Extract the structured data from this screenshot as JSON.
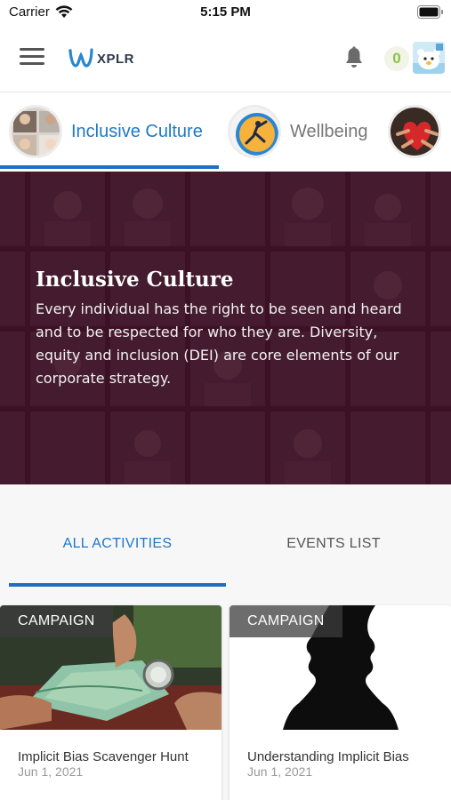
{
  "status_bar": {
    "carrier": "Carrier",
    "time": "5:15 PM"
  },
  "header": {
    "logo_text": "XPLR",
    "points": "0",
    "icons": [
      "menu-icon",
      "bell-icon",
      "avatar"
    ]
  },
  "topics": [
    {
      "label": "Inclusive Culture",
      "active": true
    },
    {
      "label": "Wellbeing",
      "active": false
    },
    {
      "label": "",
      "active": false
    }
  ],
  "hero": {
    "title": "Inclusive Culture",
    "description": "Every individual has the right to be seen and heard and to be respected for who they are. Diversity, equity and inclusion (DEI) are core elements of our corporate strategy."
  },
  "activity_tabs": [
    {
      "label": "ALL ACTIVITIES",
      "active": true
    },
    {
      "label": "EVENTS LIST",
      "active": false
    }
  ],
  "cards": [
    {
      "badge": "CAMPAIGN",
      "title": "Implicit Bias Scavenger Hunt",
      "date": "Jun 1, 2021"
    },
    {
      "badge": "CAMPAIGN",
      "title": "Understanding Implicit Bias",
      "date": "Jun 1, 2021"
    }
  ],
  "colors": {
    "accent": "#1e78c8",
    "points": "#8bc34a",
    "hero_overlay": "#4a0e2c"
  }
}
